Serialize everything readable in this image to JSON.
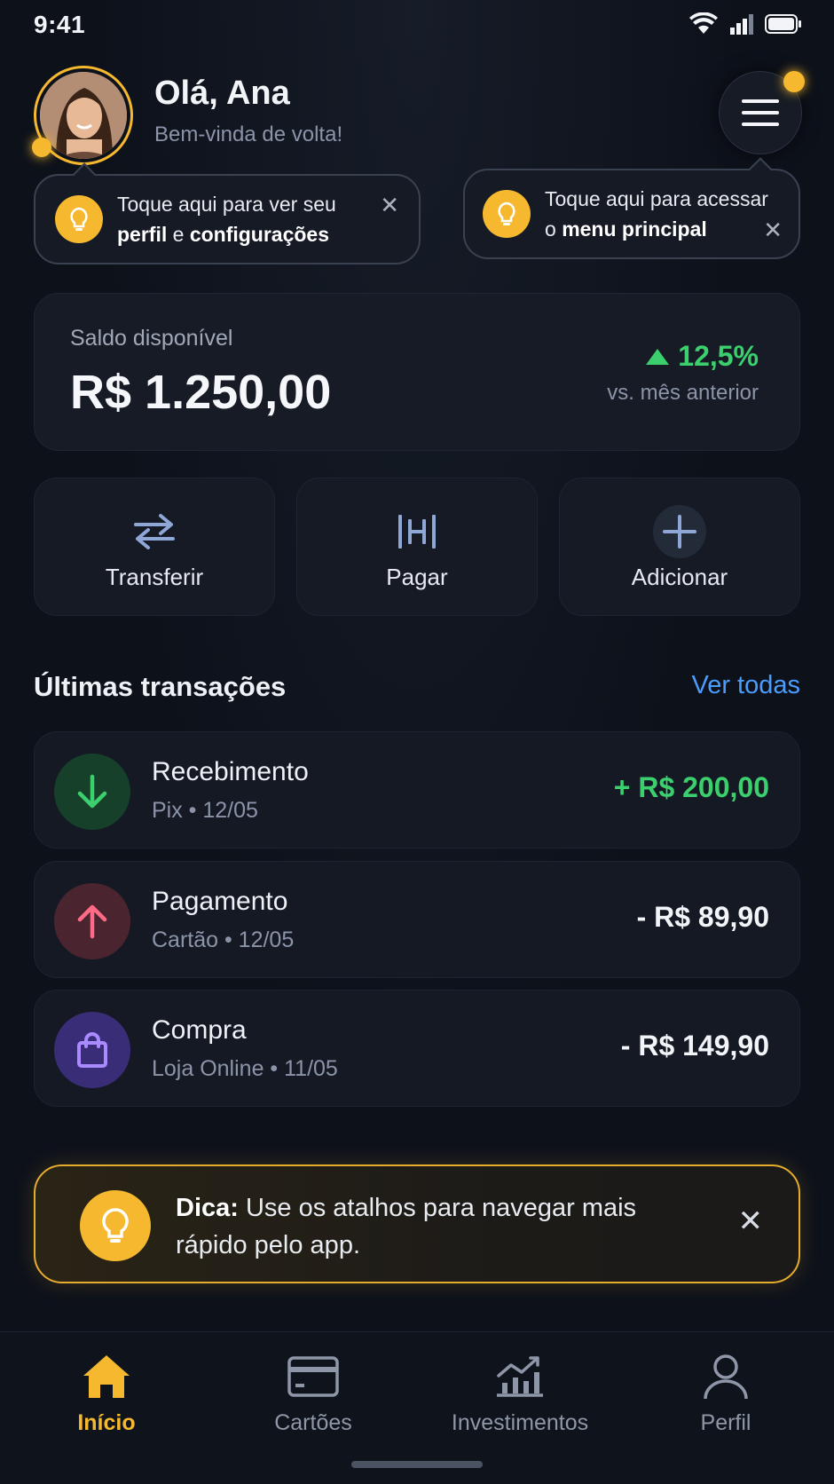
{
  "status_bar": {
    "time": "9:41"
  },
  "header": {
    "greeting": "Olá, Ana",
    "subtitle": "Bem-vinda de volta!"
  },
  "tooltips": {
    "profile": {
      "line1": "Toque aqui para ver seu",
      "bold1": "perfil",
      "joiner": " e ",
      "bold2": "configurações",
      "close": "✕"
    },
    "menu": {
      "line1": "Toque aqui para acessar",
      "prefix": "o ",
      "bold": "menu principal",
      "close": "✕"
    }
  },
  "balance": {
    "label": "Saldo disponível",
    "value": "R$ 1.250,00",
    "change": "12,5%",
    "compare": "vs. mês anterior"
  },
  "actions": [
    {
      "label": "Transferir",
      "icon": "transfer-icon"
    },
    {
      "label": "Pagar",
      "icon": "barcode-icon"
    },
    {
      "label": "Adicionar",
      "icon": "plus-icon"
    }
  ],
  "transactions": {
    "title": "Últimas transações",
    "see_all": "Ver todas",
    "items": [
      {
        "title": "Recebimento",
        "sub": "Pix • 12/05",
        "amount": "+ R$ 200,00",
        "icon": "arrow-down-icon"
      },
      {
        "title": "Pagamento",
        "sub": "Cartão • 12/05",
        "amount": "- R$ 89,90",
        "icon": "arrow-up-icon"
      },
      {
        "title": "Compra",
        "sub": "Loja Online • 11/05",
        "amount": "- R$ 149,90",
        "icon": "shopping-bag-icon"
      }
    ]
  },
  "tip_banner": {
    "bold": "Dica:",
    "text": " Use os atalhos para navegar mais rápido pelo app.",
    "close": "✕"
  },
  "bottom_nav": [
    {
      "label": "Início",
      "icon": "home-icon",
      "active": true
    },
    {
      "label": "Cartões",
      "icon": "card-icon"
    },
    {
      "label": "Investimentos",
      "icon": "chart-icon"
    },
    {
      "label": "Perfil",
      "icon": "user-icon"
    }
  ],
  "colors": {
    "background": "#0d111a",
    "accent": "#f5b82e",
    "positive": "#3ccf6e",
    "link": "#4a9dff"
  }
}
